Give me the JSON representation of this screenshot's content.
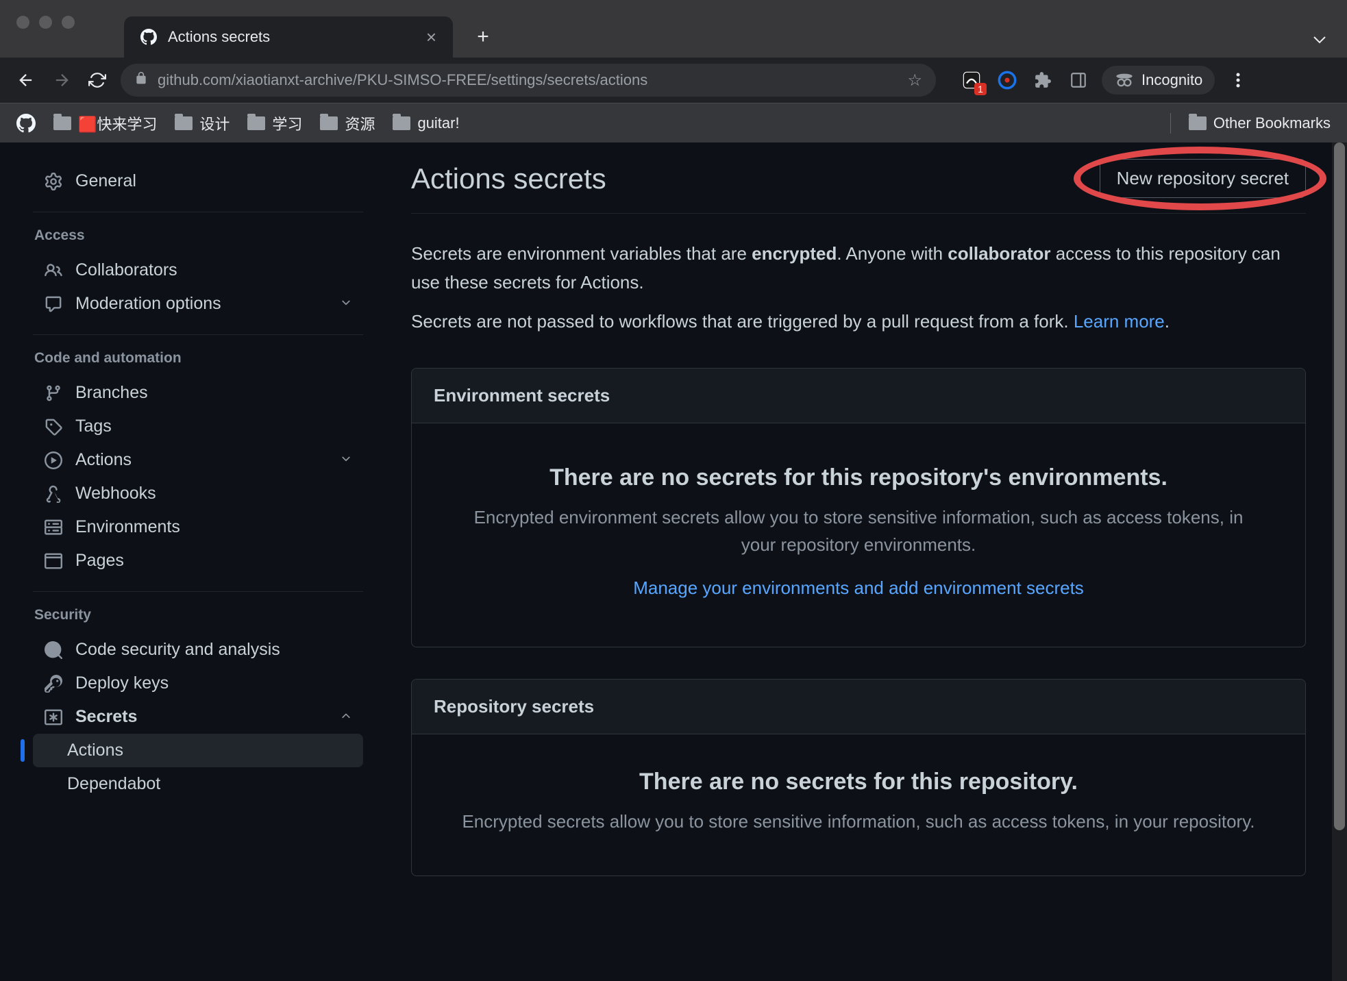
{
  "browser": {
    "tab_title": "Actions secrets",
    "url": "github.com/xiaotianxt-archive/PKU-SIMSO-FREE/settings/secrets/actions",
    "incognito_label": "Incognito",
    "ext_badge": "1",
    "other_bookmarks": "Other Bookmarks",
    "bookmarks": [
      {
        "label": "🟥快来学习"
      },
      {
        "label": "设计"
      },
      {
        "label": "学习"
      },
      {
        "label": "资源"
      },
      {
        "label": "guitar!"
      }
    ]
  },
  "sidebar": {
    "general": "General",
    "groups": {
      "access": {
        "label": "Access",
        "items": [
          {
            "label": "Collaborators"
          },
          {
            "label": "Moderation options",
            "expandable": true
          }
        ]
      },
      "code": {
        "label": "Code and automation",
        "items": [
          {
            "label": "Branches"
          },
          {
            "label": "Tags"
          },
          {
            "label": "Actions",
            "expandable": true
          },
          {
            "label": "Webhooks"
          },
          {
            "label": "Environments"
          },
          {
            "label": "Pages"
          }
        ]
      },
      "security": {
        "label": "Security",
        "items": [
          {
            "label": "Code security and analysis"
          },
          {
            "label": "Deploy keys"
          },
          {
            "label": "Secrets",
            "expandable": true,
            "expanded": true
          }
        ],
        "secret_sub": [
          {
            "label": "Actions",
            "active": true
          },
          {
            "label": "Dependabot"
          }
        ]
      }
    }
  },
  "main": {
    "title": "Actions secrets",
    "new_secret_btn": "New repository secret",
    "intro1_a": "Secrets are environment variables that are ",
    "intro1_b": "encrypted",
    "intro1_c": ". Anyone with ",
    "intro1_d": "collaborator",
    "intro1_e": " access to this repository can use these secrets for Actions.",
    "intro2_a": "Secrets are not passed to workflows that are triggered by a pull request from a fork. ",
    "intro2_link": "Learn more",
    "intro2_b": ".",
    "env_panel": {
      "header": "Environment secrets",
      "empty_title": "There are no secrets for this repository's environments.",
      "empty_desc": "Encrypted environment secrets allow you to store sensitive information, such as access tokens, in your repository environments.",
      "link": "Manage your environments and add environment secrets"
    },
    "repo_panel": {
      "header": "Repository secrets",
      "empty_title": "There are no secrets for this repository.",
      "empty_desc": "Encrypted secrets allow you to store sensitive information, such as access tokens, in your repository."
    }
  }
}
